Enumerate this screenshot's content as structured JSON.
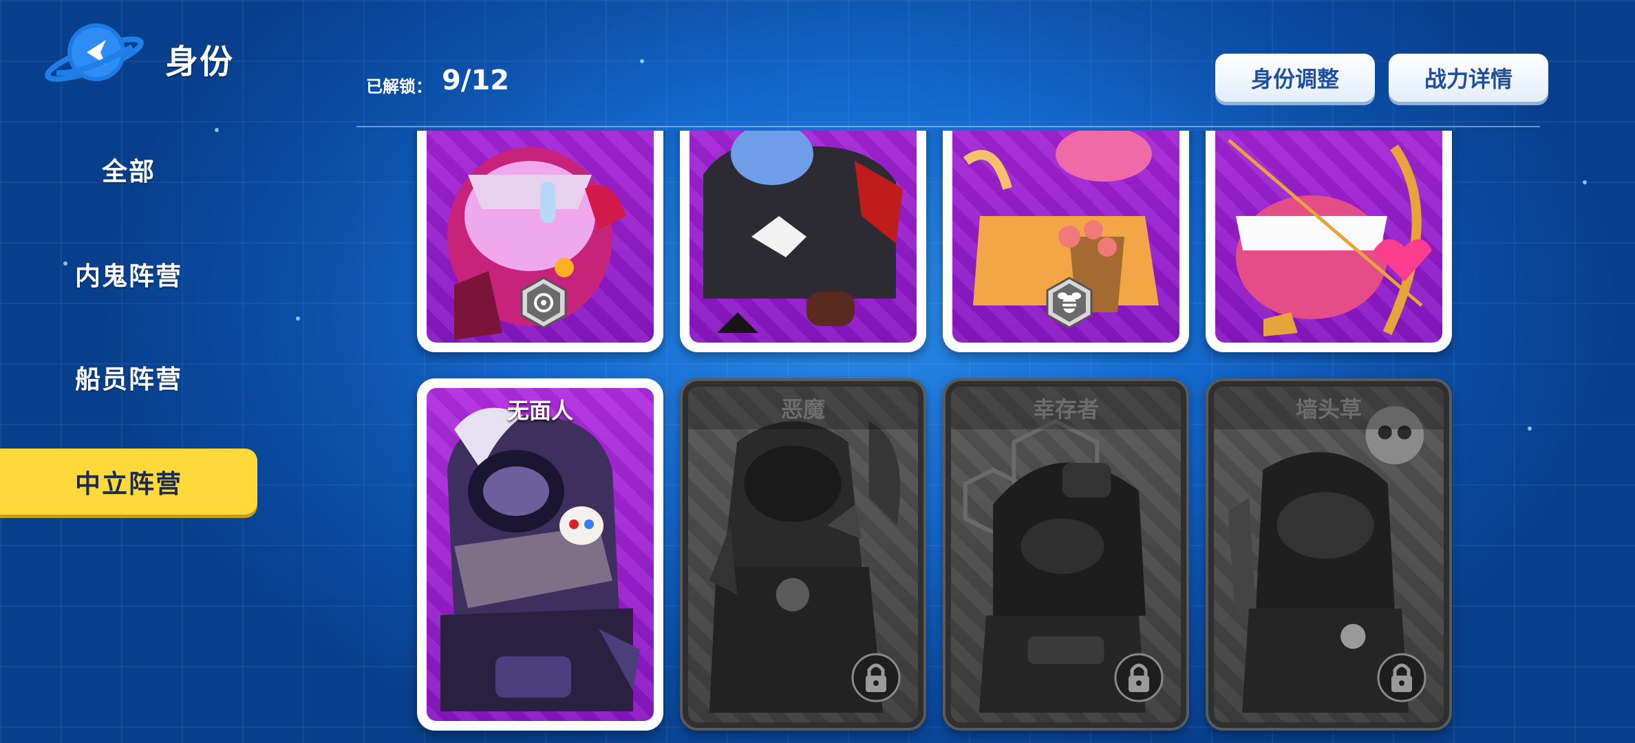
{
  "header": {
    "title": "身份",
    "unlocked_label": "已解锁：",
    "unlocked_count": "9/12",
    "btn_adjust": "身份调整",
    "btn_power": "战力详情"
  },
  "sidebar": {
    "items": [
      {
        "label": "全部"
      },
      {
        "label": "内鬼阵营"
      },
      {
        "label": "船员阵营"
      },
      {
        "label": "中立阵营"
      }
    ],
    "active_index": 3
  },
  "cards_top": [
    {
      "name": "",
      "locked": false,
      "badge": "swirl-icon"
    },
    {
      "name": "",
      "locked": false,
      "badge": ""
    },
    {
      "name": "",
      "locked": false,
      "badge": "bee-icon"
    },
    {
      "name": "",
      "locked": false,
      "badge": ""
    }
  ],
  "cards_bottom": [
    {
      "name": "无面人",
      "locked": false
    },
    {
      "name": "恶魔",
      "locked": true
    },
    {
      "name": "幸存者",
      "locked": true
    },
    {
      "name": "墙头草",
      "locked": true
    }
  ],
  "colors": {
    "accent_yellow": "#ffd93a",
    "card_purple": "#a020d8",
    "locked_gray": "#4a4a4a",
    "button_text": "#1f4ea0"
  }
}
